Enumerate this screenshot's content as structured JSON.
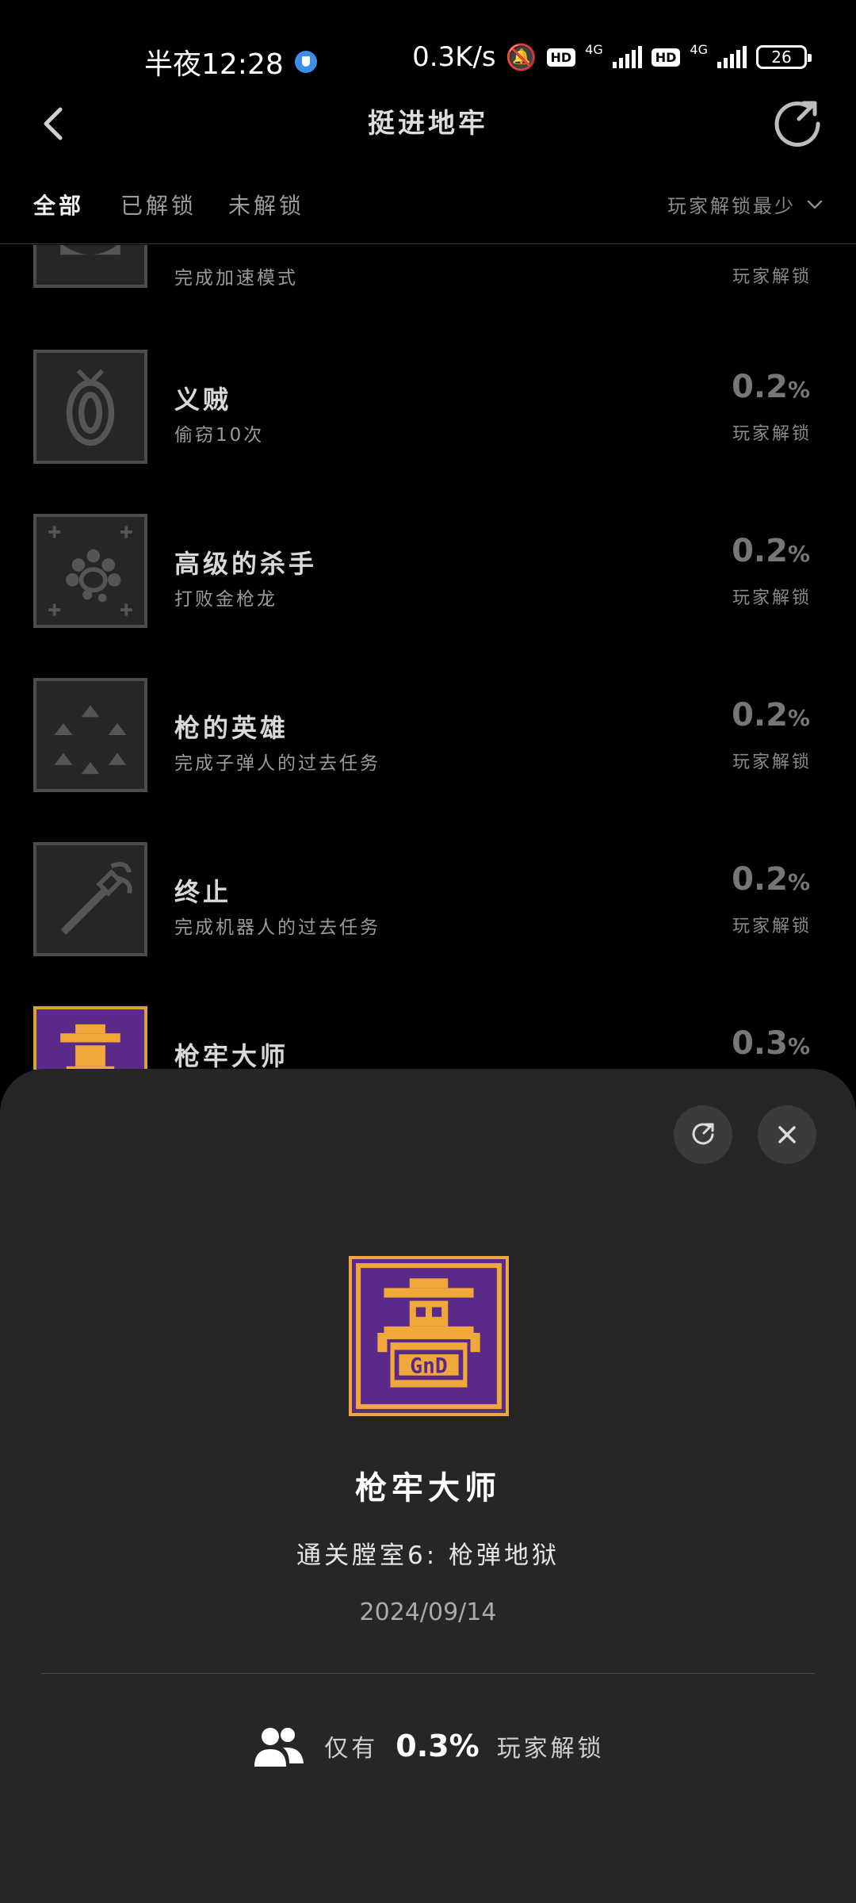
{
  "status_bar": {
    "time": "半夜12:28",
    "network_speed": "0.3K/s",
    "hd_badge": "HD",
    "net_type": "4G",
    "battery": "26"
  },
  "header": {
    "title": "挺进地牢"
  },
  "tabs": [
    {
      "label": "全部",
      "active": true
    },
    {
      "label": "已解锁",
      "active": false
    },
    {
      "label": "未解锁",
      "active": false
    }
  ],
  "sort": {
    "label": "玩家解锁最少"
  },
  "achievements": [
    {
      "name": "",
      "desc": "完成加速模式",
      "percent": "",
      "unlock_label": "玩家解锁",
      "icon": "partial-icon"
    },
    {
      "name": "义贼",
      "desc": "偷窃10次",
      "percent": "0.2",
      "unlock_label": "玩家解锁",
      "icon": "eye-icon"
    },
    {
      "name": "高级的杀手",
      "desc": "打败金枪龙",
      "percent": "0.2",
      "unlock_label": "玩家解锁",
      "icon": "dragon-icon"
    },
    {
      "name": "枪的英雄",
      "desc": "完成子弹人的过去任务",
      "percent": "0.2",
      "unlock_label": "玩家解锁",
      "icon": "bullets-icon"
    },
    {
      "name": "终止",
      "desc": "完成机器人的过去任务",
      "percent": "0.2",
      "unlock_label": "玩家解锁",
      "icon": "wrench-icon"
    },
    {
      "name": "枪牢大师",
      "desc": "",
      "percent": "0.3",
      "unlock_label": "",
      "icon": "gungeon-master-icon"
    }
  ],
  "percent_unit": "%",
  "detail": {
    "title": "枪牢大师",
    "description": "通关膛室6: 枪弹地狱",
    "date": "2024/09/14",
    "stat_prefix": "仅有",
    "stat_value": "0.3%",
    "stat_suffix": "玩家解锁"
  }
}
